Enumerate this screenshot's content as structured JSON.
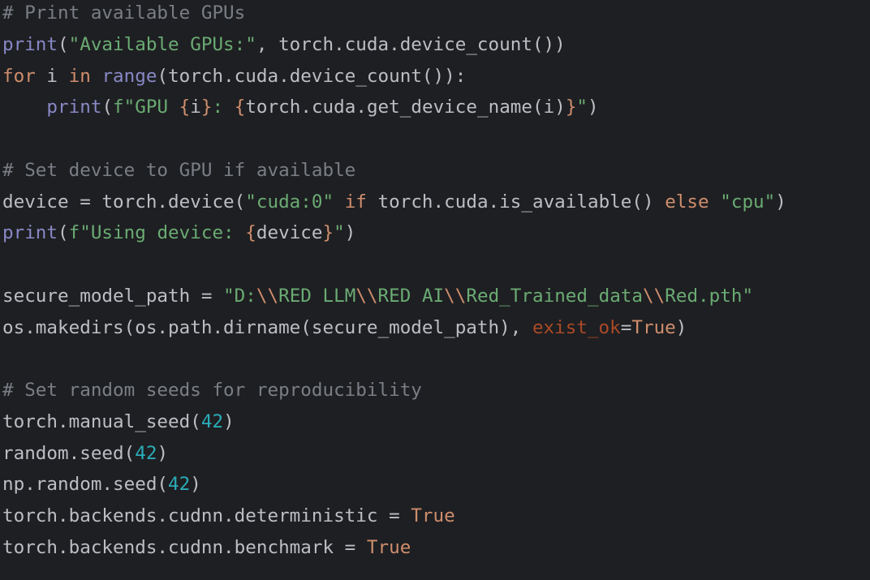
{
  "code": {
    "language": "python",
    "lines": [
      [
        {
          "t": "# Print available GPUs",
          "k": "comment"
        }
      ],
      [
        {
          "t": "print",
          "k": "builtin"
        },
        {
          "t": "(",
          "k": "plain"
        },
        {
          "t": "\"Available GPUs:\"",
          "k": "str"
        },
        {
          "t": ", torch.cuda.device_count())",
          "k": "plain"
        }
      ],
      [
        {
          "t": "for",
          "k": "kw"
        },
        {
          "t": " i ",
          "k": "plain"
        },
        {
          "t": "in",
          "k": "kw"
        },
        {
          "t": " ",
          "k": "plain"
        },
        {
          "t": "range",
          "k": "builtin"
        },
        {
          "t": "(torch.cuda.device_count()):",
          "k": "plain"
        }
      ],
      [
        {
          "t": "    ",
          "k": "plain"
        },
        {
          "t": "print",
          "k": "builtin"
        },
        {
          "t": "(",
          "k": "plain"
        },
        {
          "t": "f\"GPU ",
          "k": "str"
        },
        {
          "t": "{",
          "k": "kw"
        },
        {
          "t": "i",
          "k": "plain"
        },
        {
          "t": "}",
          "k": "kw"
        },
        {
          "t": ": ",
          "k": "str"
        },
        {
          "t": "{",
          "k": "kw"
        },
        {
          "t": "torch.cuda.get_device_name(i)",
          "k": "plain"
        },
        {
          "t": "}",
          "k": "kw"
        },
        {
          "t": "\"",
          "k": "str"
        },
        {
          "t": ")",
          "k": "plain"
        }
      ],
      [],
      [
        {
          "t": "# Set device to GPU if available",
          "k": "comment"
        }
      ],
      [
        {
          "t": "device = torch.device(",
          "k": "plain"
        },
        {
          "t": "\"cuda:0\"",
          "k": "str"
        },
        {
          "t": " ",
          "k": "plain"
        },
        {
          "t": "if",
          "k": "kw"
        },
        {
          "t": " torch.cuda.is_available() ",
          "k": "plain"
        },
        {
          "t": "else",
          "k": "kw"
        },
        {
          "t": " ",
          "k": "plain"
        },
        {
          "t": "\"cpu\"",
          "k": "str"
        },
        {
          "t": ")",
          "k": "plain"
        }
      ],
      [
        {
          "t": "print",
          "k": "builtin"
        },
        {
          "t": "(",
          "k": "plain"
        },
        {
          "t": "f\"Using device: ",
          "k": "str"
        },
        {
          "t": "{",
          "k": "kw"
        },
        {
          "t": "device",
          "k": "plain"
        },
        {
          "t": "}",
          "k": "kw"
        },
        {
          "t": "\"",
          "k": "str"
        },
        {
          "t": ")",
          "k": "plain"
        }
      ],
      [],
      [
        {
          "t": "secure_model_path = ",
          "k": "plain"
        },
        {
          "t": "\"D:",
          "k": "str"
        },
        {
          "t": "\\\\",
          "k": "esc"
        },
        {
          "t": "RED LLM",
          "k": "str"
        },
        {
          "t": "\\\\",
          "k": "esc"
        },
        {
          "t": "RED AI",
          "k": "str"
        },
        {
          "t": "\\\\",
          "k": "esc"
        },
        {
          "t": "Red_Trained_data",
          "k": "str"
        },
        {
          "t": "\\\\",
          "k": "esc"
        },
        {
          "t": "Red.pth\"",
          "k": "str"
        }
      ],
      [
        {
          "t": "os.makedirs(os.path.dirname(secure_model_path), ",
          "k": "plain"
        },
        {
          "t": "exist_ok",
          "k": "param"
        },
        {
          "t": "=",
          "k": "plain"
        },
        {
          "t": "True",
          "k": "kw"
        },
        {
          "t": ")",
          "k": "plain"
        }
      ],
      [],
      [
        {
          "t": "# Set random seeds for reproducibility",
          "k": "comment"
        }
      ],
      [
        {
          "t": "torch.manual_seed(",
          "k": "plain"
        },
        {
          "t": "42",
          "k": "num"
        },
        {
          "t": ")",
          "k": "plain"
        }
      ],
      [
        {
          "t": "random.seed(",
          "k": "plain"
        },
        {
          "t": "42",
          "k": "num"
        },
        {
          "t": ")",
          "k": "plain"
        }
      ],
      [
        {
          "t": "np.random.seed(",
          "k": "plain"
        },
        {
          "t": "42",
          "k": "num"
        },
        {
          "t": ")",
          "k": "plain"
        }
      ],
      [
        {
          "t": "torch.backends.cudnn.deterministic = ",
          "k": "plain"
        },
        {
          "t": "True",
          "k": "kw"
        }
      ],
      [
        {
          "t": "torch.backends.cudnn.benchmark = ",
          "k": "plain"
        },
        {
          "t": "True",
          "k": "kw"
        }
      ]
    ]
  },
  "colors": {
    "background": "#1e1f22",
    "plain": "#bcbec4",
    "comment": "#7a7e85",
    "keyword": "#cf8e6d",
    "builtin": "#8888c6",
    "string": "#6aab73",
    "number": "#2aacb8",
    "parameter": "#aa4926"
  }
}
